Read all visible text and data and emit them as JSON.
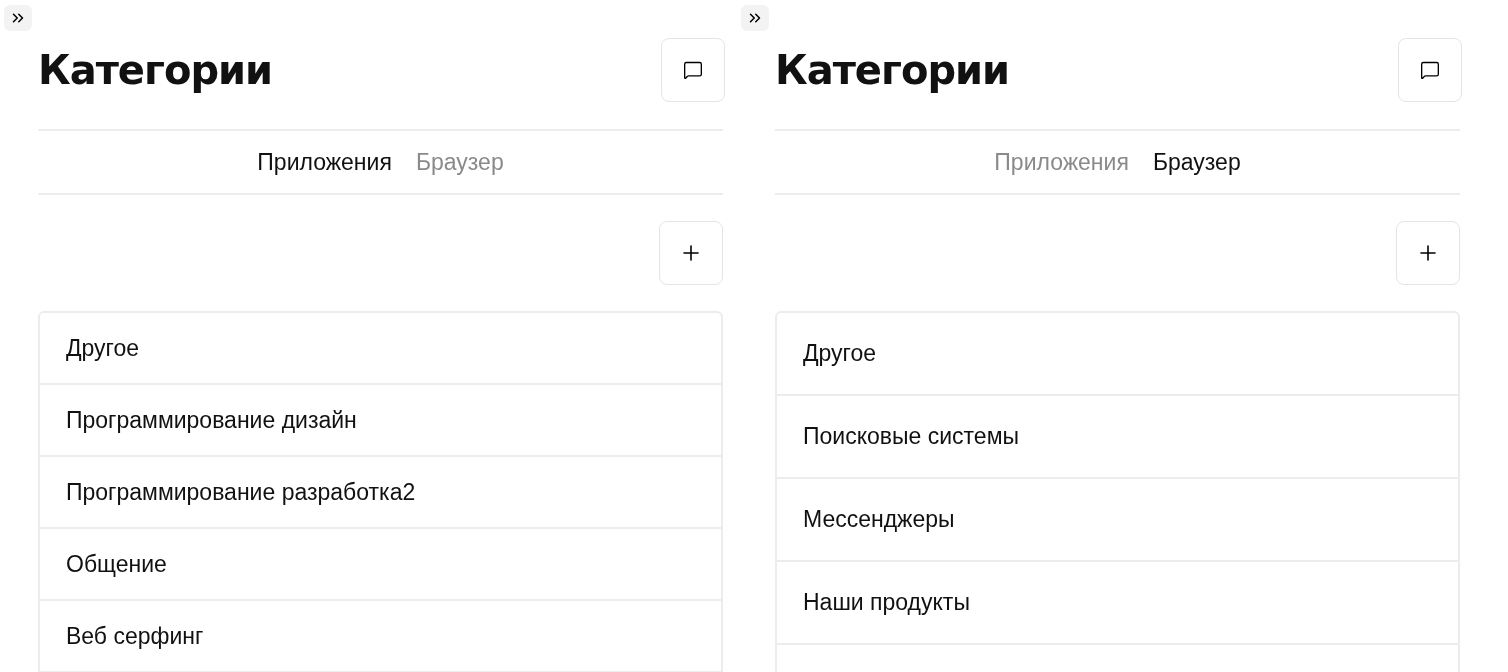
{
  "panels": [
    {
      "title": "Категории",
      "tabs": [
        {
          "label": "Приложения",
          "selected": true
        },
        {
          "label": "Браузер",
          "selected": false
        }
      ],
      "categories": [
        {
          "label": "Другое"
        },
        {
          "label": "Программирование дизайн"
        },
        {
          "label": "Программирование разработка2"
        },
        {
          "label": "Общение"
        },
        {
          "label": "Веб серфинг"
        }
      ]
    },
    {
      "title": "Категории",
      "tabs": [
        {
          "label": "Приложения",
          "selected": false
        },
        {
          "label": "Браузер",
          "selected": true
        }
      ],
      "categories": [
        {
          "label": "Другое"
        },
        {
          "label": "Поисковые системы"
        },
        {
          "label": "Мессенджеры"
        },
        {
          "label": "Наши продукты"
        }
      ]
    }
  ]
}
